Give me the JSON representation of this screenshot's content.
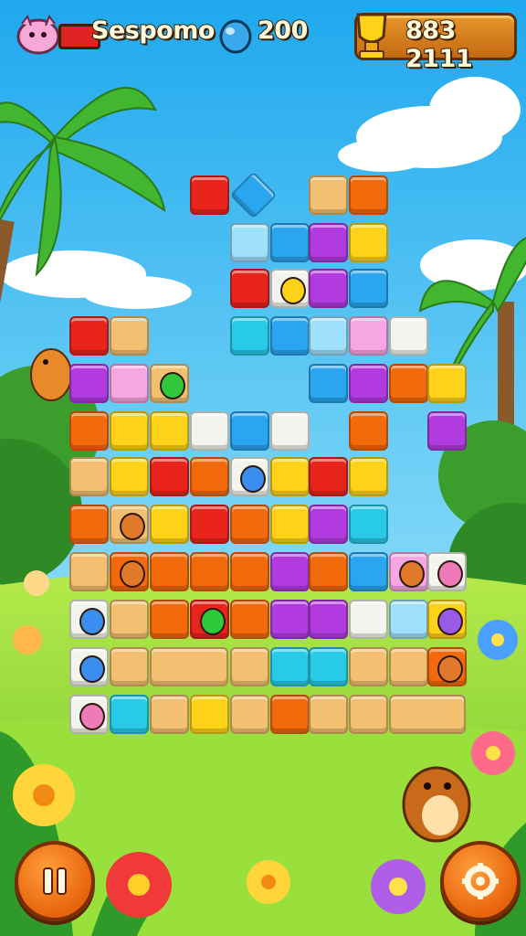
{
  "hud": {
    "player_name": "Sespomo",
    "gem_count": "200",
    "score": "883 2111"
  },
  "buttons": {
    "pause_icon": "pause-icon",
    "settings_icon": "gear-icon"
  },
  "colors": {
    "red": "#e8241c",
    "orange": "#f26a0c",
    "yellow": "#ffd21a",
    "tan": "#f2c070",
    "purple": "#b23be0",
    "blue": "#2aa6f0",
    "lightblue": "#9fe0fb",
    "pink": "#f6a6e0",
    "white": "#f4f4ee",
    "cyan": "#29c9e8",
    "sky_top": "#2db4f2",
    "grass": "#8fd83a"
  },
  "board": {
    "tiles": [
      [
        "red",
        "tan",
        "yellow",
        "purple-card",
        "blue",
        "white",
        "",
        "",
        "",
        "",
        "",
        ""
      ],
      [
        "orange",
        "yellow",
        "yellow",
        "orange",
        "",
        "",
        "",
        "",
        "",
        "",
        ""
      ]
    ]
  }
}
